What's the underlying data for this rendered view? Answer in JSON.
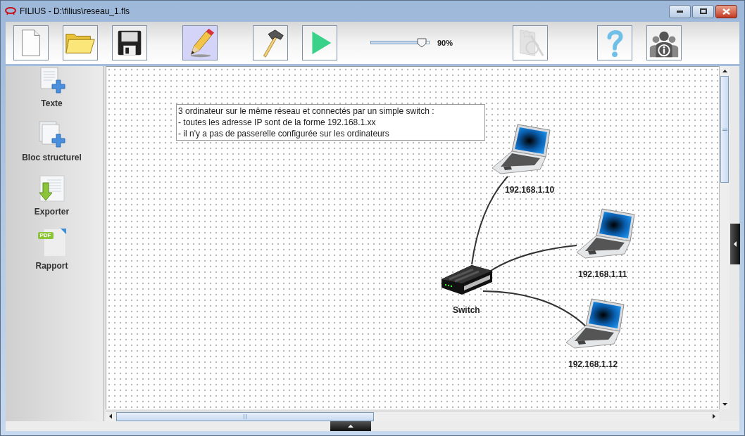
{
  "window": {
    "title": "FILIUS - D:\\filius\\reseau_1.fls"
  },
  "toolbar": {
    "left_buttons": [
      {
        "kind": "new",
        "selected": false,
        "disabled": false
      },
      {
        "kind": "open",
        "selected": false,
        "disabled": false
      },
      {
        "kind": "save",
        "selected": false,
        "disabled": false
      },
      {
        "kind": "design",
        "selected": true,
        "disabled": false
      },
      {
        "kind": "build",
        "selected": false,
        "disabled": false
      },
      {
        "kind": "run",
        "selected": false,
        "disabled": false
      }
    ],
    "zoom": {
      "level": 0.9,
      "reading": "90%"
    },
    "right_buttons": [
      {
        "kind": "wizard",
        "selected": false,
        "disabled": true
      },
      {
        "kind": "help",
        "selected": false,
        "disabled": false
      },
      {
        "kind": "about",
        "selected": false,
        "disabled": false
      }
    ]
  },
  "sidebar": {
    "items": [
      {
        "kind": "text",
        "label": "Texte"
      },
      {
        "kind": "block",
        "label": "Bloc structurel"
      },
      {
        "kind": "export",
        "label": "Exporter"
      },
      {
        "kind": "report",
        "label": "Rapport",
        "badge": "PDF"
      }
    ]
  },
  "canvas": {
    "note": {
      "lines": [
        "3 ordinateur sur le même réseau et connectés par un simple switch :",
        "- toutes les adresse IP sont de la forme 192.168.1.xx",
        "- il n'y a pas de passerelle configurée sur les ordinateurs"
      ]
    },
    "nodes": [
      {
        "kind": "laptop",
        "label": "192.168.1.10",
        "cabled": true
      },
      {
        "kind": "laptop",
        "label": "192.168.1.11",
        "cabled": true
      },
      {
        "kind": "laptop",
        "label": "192.168.1.12",
        "cabled": true
      },
      {
        "kind": "switch",
        "label": "Switch"
      }
    ]
  }
}
